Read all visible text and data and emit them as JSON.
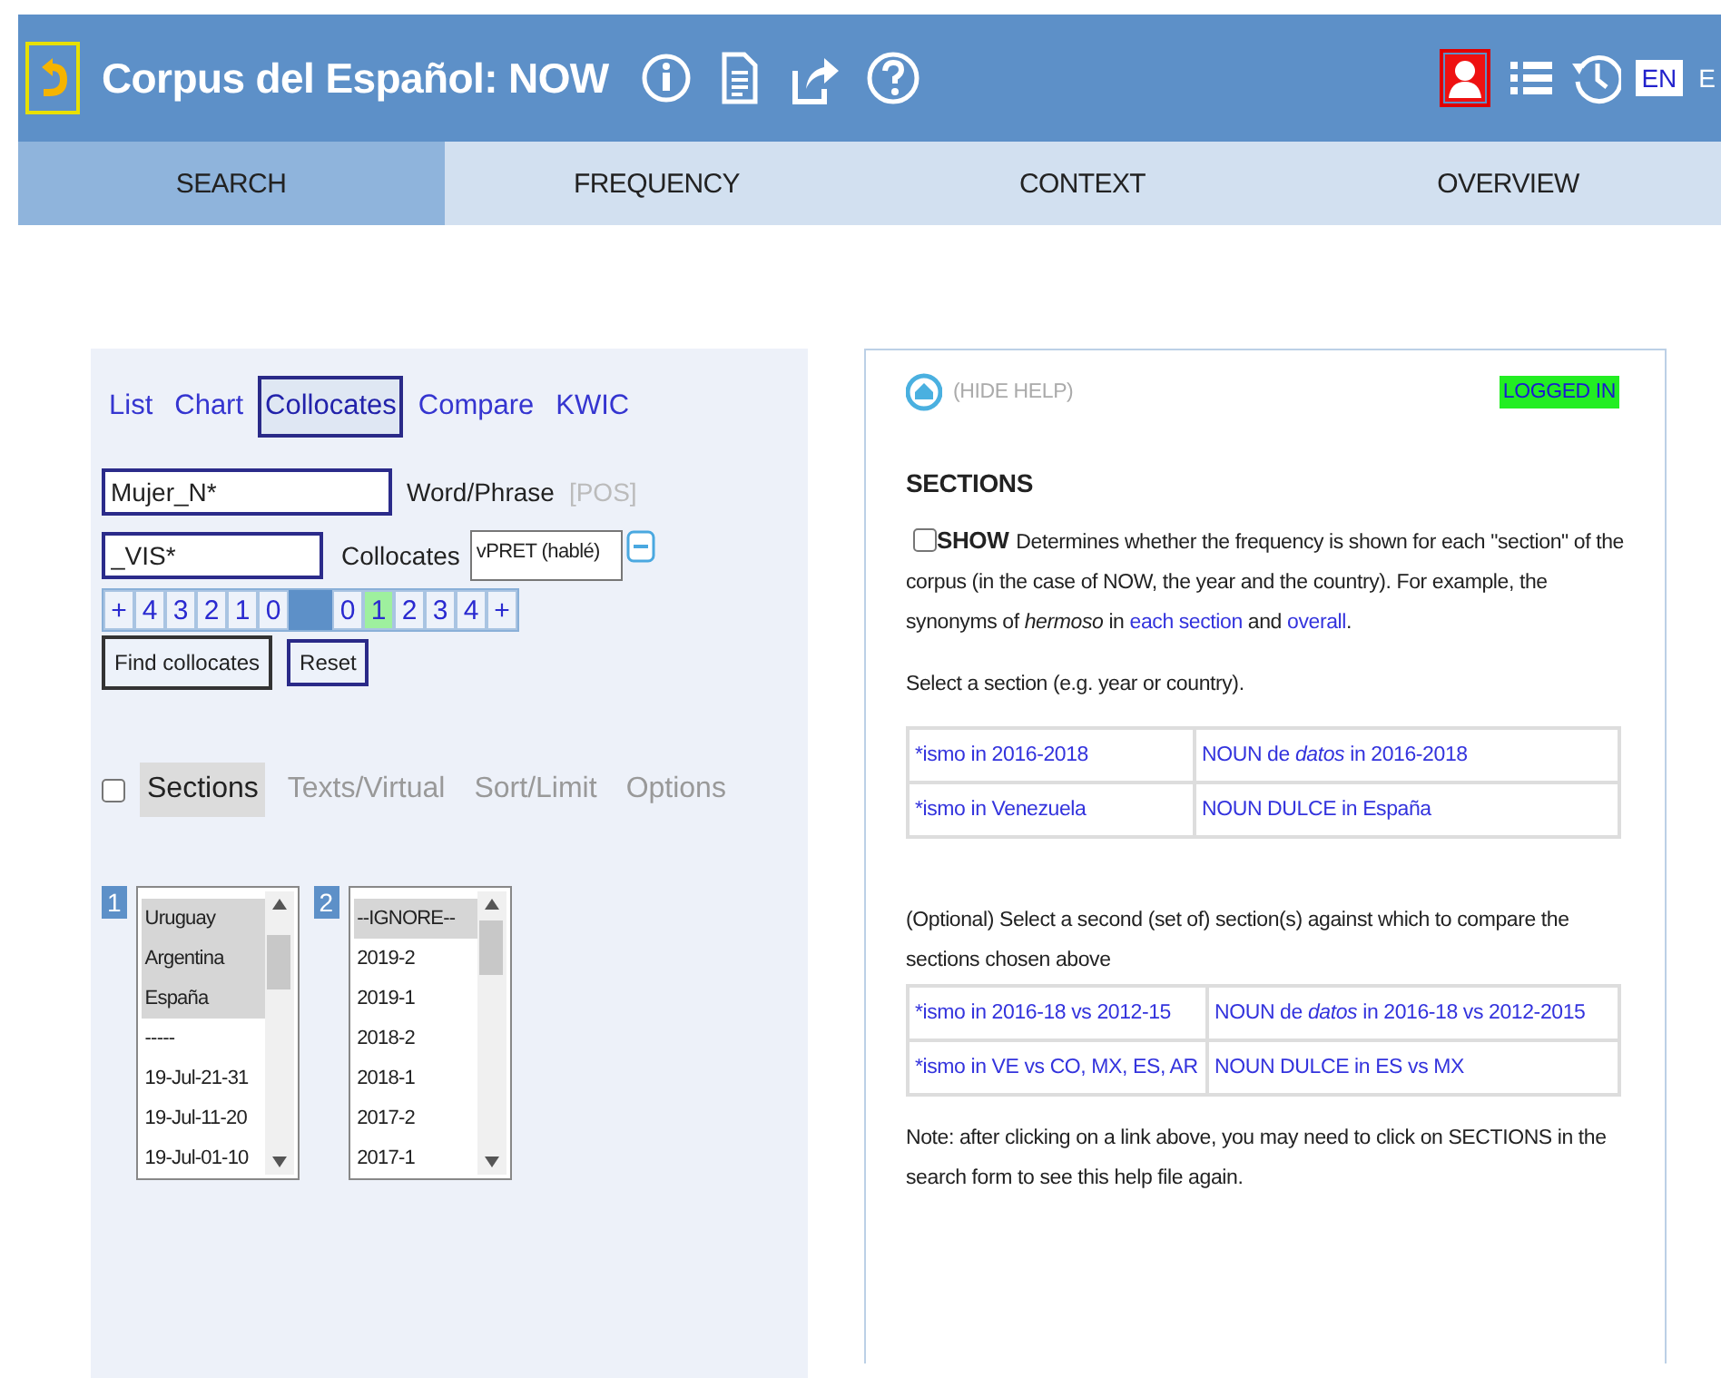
{
  "header": {
    "title": "Corpus del Español: NOW",
    "languages": [
      {
        "label": "EN",
        "selected": true
      },
      {
        "label": "E",
        "selected": false
      }
    ]
  },
  "nav_tabs": [
    {
      "label": "SEARCH",
      "selected": true
    },
    {
      "label": "FREQUENCY",
      "selected": false
    },
    {
      "label": "CONTEXT",
      "selected": false
    },
    {
      "label": "OVERVIEW",
      "selected": false
    }
  ],
  "search_form": {
    "modes": [
      {
        "label": "List",
        "selected": false
      },
      {
        "label": "Chart",
        "selected": false
      },
      {
        "label": "Collocates",
        "selected": true
      },
      {
        "label": "Compare",
        "selected": false
      },
      {
        "label": "KWIC",
        "selected": false
      }
    ],
    "word_field": {
      "value": "Mujer_N*",
      "label": "Word/Phrase",
      "pos_link": "[POS]"
    },
    "collocates_field": {
      "value": "_VIS*",
      "label": "Collocates",
      "dropdown": "vPRET (hablé)"
    },
    "span_left": [
      {
        "label": "+",
        "selected": false
      },
      {
        "label": "4",
        "selected": false
      },
      {
        "label": "3",
        "selected": false
      },
      {
        "label": "2",
        "selected": false
      },
      {
        "label": "1",
        "selected": false
      },
      {
        "label": "0",
        "selected": false
      }
    ],
    "span_right": [
      {
        "label": "0",
        "selected": false
      },
      {
        "label": "1",
        "selected": true
      },
      {
        "label": "2",
        "selected": false
      },
      {
        "label": "3",
        "selected": false
      },
      {
        "label": "4",
        "selected": false
      },
      {
        "label": "+",
        "selected": false
      }
    ],
    "buttons": [
      "Find collocates",
      "Reset"
    ],
    "limit_checked": false,
    "option_tabs": [
      {
        "label": "Sections",
        "selected": true
      },
      {
        "label": "Texts/Virtual",
        "selected": false
      },
      {
        "label": "Sort/Limit",
        "selected": false
      },
      {
        "label": "Options",
        "selected": false
      }
    ],
    "section_lists": [
      {
        "number": "1",
        "items": [
          {
            "label": "Uruguay",
            "selected": true
          },
          {
            "label": "Argentina",
            "selected": true
          },
          {
            "label": "España",
            "selected": true
          },
          {
            "label": "-----",
            "selected": false
          },
          {
            "label": "19-Jul-21-31",
            "selected": false
          },
          {
            "label": "19-Jul-11-20",
            "selected": false
          },
          {
            "label": "19-Jul-01-10",
            "selected": false
          }
        ]
      },
      {
        "number": "2",
        "items": [
          {
            "label": "--IGNORE--",
            "selected": true
          },
          {
            "label": "2019-2",
            "selected": false
          },
          {
            "label": "2019-1",
            "selected": false
          },
          {
            "label": "2018-2",
            "selected": false
          },
          {
            "label": "2018-1",
            "selected": false
          },
          {
            "label": "2017-2",
            "selected": false
          },
          {
            "label": "2017-1",
            "selected": false
          }
        ]
      }
    ]
  },
  "help": {
    "hide_help": "(HIDE HELP)",
    "status": "LOGGED IN",
    "heading": "SECTIONS",
    "show_checked": false,
    "show_label": "SHOW",
    "intro": [
      {
        "kind": "text",
        "text": "Determines whether the frequency is shown for each \"section\" of the corpus (in the case of NOW, the year and the country). For example, the synonyms of *hermoso* in "
      },
      {
        "kind": "link",
        "text": "each section"
      },
      {
        "kind": "text",
        "text": " and "
      },
      {
        "kind": "link",
        "text": "overall"
      },
      {
        "kind": "text",
        "text": "."
      }
    ],
    "prompt": "Select a section (e.g. year or country).",
    "table_1": [
      [
        "*ismo in 2016-2018",
        "NOUN de *datos* in 2016-2018"
      ],
      [
        "*ismo in Venezuela",
        "NOUN DULCE in España"
      ]
    ],
    "prompt_2": "(Optional) Select a second (set of) section(s) against which to compare the sections chosen above",
    "table_2": [
      [
        "*ismo in 2016-18 vs 2012-15",
        "NOUN de *datos* in 2016-18 vs 2012-2015"
      ],
      [
        "*ismo in VE vs CO, MX, ES, AR",
        "NOUN DULCE in ES vs MX"
      ]
    ],
    "note": "Note: after clicking on a link above, you may need to click on SECTIONS in the search form to see this help file again."
  }
}
